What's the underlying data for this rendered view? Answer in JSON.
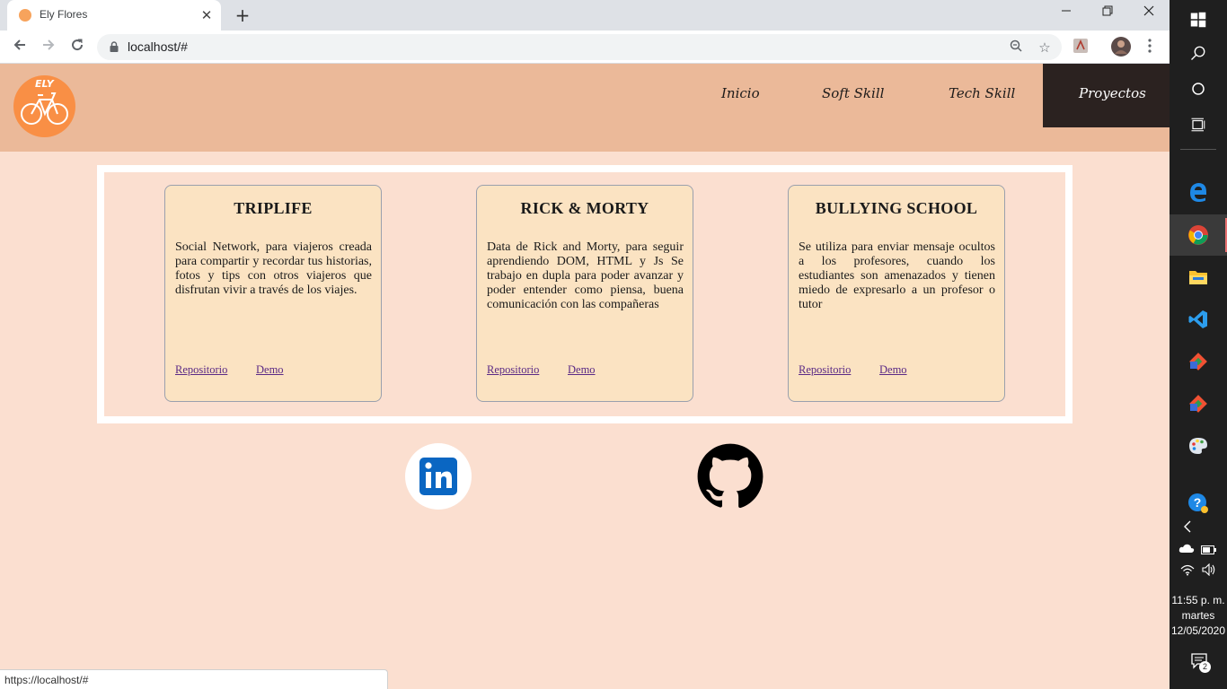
{
  "browser": {
    "tab_title": "Ely Flores",
    "url": "localhost/#",
    "status_url": "https://localhost/#"
  },
  "site": {
    "logo_text": "ELY",
    "nav": [
      {
        "label": "Inicio"
      },
      {
        "label": "Soft Skill"
      },
      {
        "label": "Tech Skill"
      },
      {
        "label": "Proyectos",
        "active": true
      }
    ],
    "projects": [
      {
        "title": "TRIPLIFE",
        "description": "Social Network, para viajeros creada para compartir y recordar tus historias, fotos y tips con otros viajeros que disfrutan vivir a través de los viajes.",
        "repo_label": "Repositorio",
        "demo_label": "Demo"
      },
      {
        "title": "RICK & MORTY",
        "description": "Data de Rick and Morty, para seguir aprendiendo DOM, HTML y Js Se trabajo en dupla para poder avanzar y poder entender como piensa, buena comunicación con las compañeras",
        "repo_label": "Repositorio",
        "demo_label": "Demo"
      },
      {
        "title": "BULLYING SCHOOL",
        "description": "Se utiliza para enviar mensaje ocultos a los profesores, cuando los estudiantes son amenazados y tienen miedo de expresarlo a un profesor o tutor",
        "repo_label": "Repositorio",
        "demo_label": "Demo"
      }
    ],
    "social": {
      "linkedin_label": "in"
    }
  },
  "taskbar": {
    "time": "11:55 p. m.",
    "day": "martes",
    "date": "12/05/2020",
    "notification_count": "2"
  },
  "colors": {
    "header_bg": "#ebb999",
    "page_bg": "#fbdfd0",
    "card_bg": "#fbe3c2",
    "active_nav_bg": "#2b2220",
    "logo_bg": "#f98f45",
    "link_color": "#5b2a86",
    "linkedin_blue": "#0a66c2"
  }
}
